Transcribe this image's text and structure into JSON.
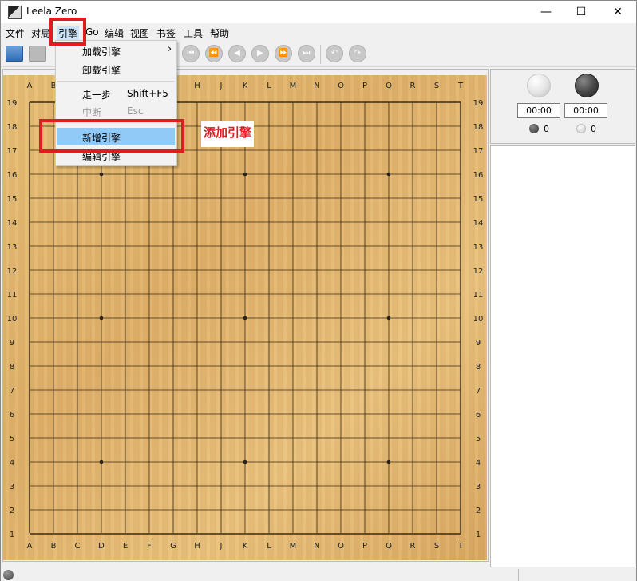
{
  "window": {
    "title": "Leela Zero",
    "minimize": "—",
    "maximize": "☐",
    "close": "✕"
  },
  "menubar": [
    "文件",
    "对局",
    "引擎",
    "Go",
    "编辑",
    "视图",
    "书签",
    "工具",
    "帮助"
  ],
  "engine_menu": {
    "items": [
      {
        "label": "加载引擎",
        "submenu_arrow": "›"
      },
      {
        "label": "卸载引擎"
      },
      {
        "label": "走一步",
        "shortcut": "Shift+F5"
      },
      {
        "label": "中断",
        "shortcut": "Esc",
        "disabled": true
      },
      {
        "label": "新增引擎",
        "highlighted": true
      },
      {
        "label": "编辑引擎"
      }
    ]
  },
  "annotation": {
    "text": "添加引擎",
    "color": "#e11b22"
  },
  "board": {
    "size": 19,
    "columns": [
      "A",
      "B",
      "C",
      "D",
      "E",
      "F",
      "G",
      "H",
      "J",
      "K",
      "L",
      "M",
      "N",
      "O",
      "P",
      "Q",
      "R",
      "S",
      "T"
    ],
    "rows": [
      "19",
      "18",
      "17",
      "16",
      "15",
      "14",
      "13",
      "12",
      "11",
      "10",
      "9",
      "8",
      "7",
      "6",
      "5",
      "4",
      "3",
      "2",
      "1"
    ],
    "star_points": [
      "D16",
      "K16",
      "Q16",
      "D10",
      "K10",
      "Q10",
      "D4",
      "K4",
      "Q4"
    ]
  },
  "players": {
    "white_time": "00:00",
    "black_time": "00:00",
    "black_captures": "0",
    "white_captures": "0"
  }
}
